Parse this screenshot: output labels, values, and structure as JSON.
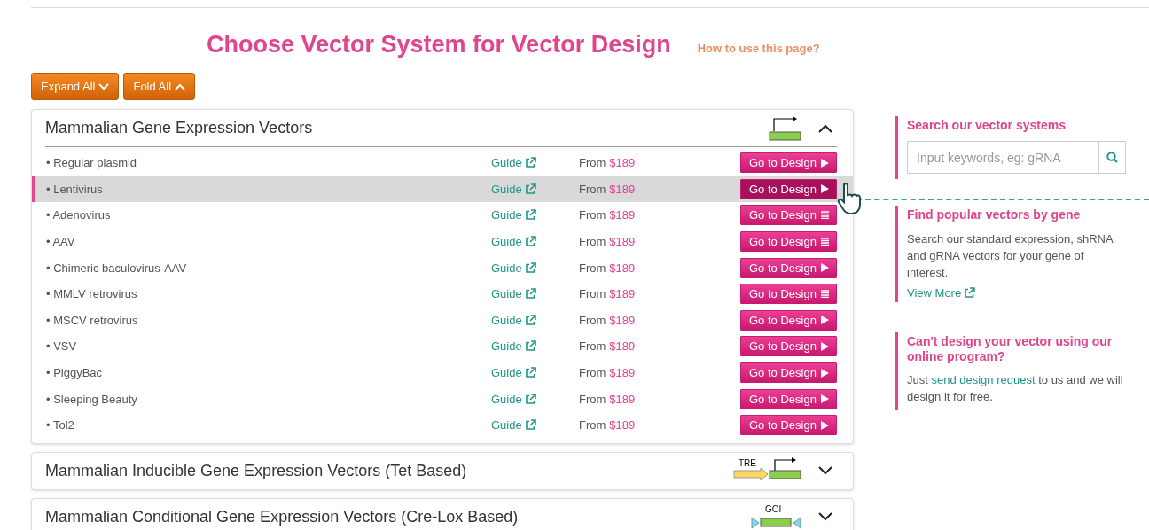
{
  "header": {
    "title": "Choose Vector System for Vector Design",
    "help_link": "How to use this page?"
  },
  "toolbar": [
    {
      "label": "Expand All",
      "kind": "expand"
    },
    {
      "label": "Fold All",
      "kind": "fold"
    }
  ],
  "panels": [
    {
      "title": "Mammalian Gene Expression Vectors",
      "expanded": true,
      "diagram": {
        "kind": "promoter"
      },
      "rows": [
        {
          "name": "• Regular plasmid",
          "guide": "Guide",
          "price_prefix": "From",
          "price": "$189",
          "button": {
            "label": "Go to Design",
            "kind": "play"
          },
          "selected": false
        },
        {
          "name": "• Lentivirus",
          "guide": "Guide",
          "price_prefix": "From",
          "price": "$189",
          "button": {
            "label": "Go to Design",
            "kind": "play"
          },
          "selected": true
        },
        {
          "name": "• Adenovirus",
          "guide": "Guide",
          "price_prefix": "From",
          "price": "$189",
          "button": {
            "label": "Go to Design",
            "kind": "list"
          },
          "selected": false
        },
        {
          "name": "• AAV",
          "guide": "Guide",
          "price_prefix": "From",
          "price": "$189",
          "button": {
            "label": "Go to Design",
            "kind": "list"
          },
          "selected": false
        },
        {
          "name": "• Chimeric baculovirus-AAV",
          "guide": "Guide",
          "price_prefix": "From",
          "price": "$189",
          "button": {
            "label": "Go to Design",
            "kind": "play"
          },
          "selected": false
        },
        {
          "name": "• MMLV retrovirus",
          "guide": "Guide",
          "price_prefix": "From",
          "price": "$189",
          "button": {
            "label": "Go to Design",
            "kind": "list"
          },
          "selected": false
        },
        {
          "name": "• MSCV retrovirus",
          "guide": "Guide",
          "price_prefix": "From",
          "price": "$189",
          "button": {
            "label": "Go to Design",
            "kind": "play"
          },
          "selected": false
        },
        {
          "name": "• VSV",
          "guide": "Guide",
          "price_prefix": "From",
          "price": "$189",
          "button": {
            "label": "Go to Design",
            "kind": "play"
          },
          "selected": false
        },
        {
          "name": "• PiggyBac",
          "guide": "Guide",
          "price_prefix": "From",
          "price": "$189",
          "button": {
            "label": "Go to Design",
            "kind": "play"
          },
          "selected": false
        },
        {
          "name": "• Sleeping Beauty",
          "guide": "Guide",
          "price_prefix": "From",
          "price": "$189",
          "button": {
            "label": "Go to Design",
            "kind": "play"
          },
          "selected": false
        },
        {
          "name": "• Tol2",
          "guide": "Guide",
          "price_prefix": "From",
          "price": "$189",
          "button": {
            "label": "Go to Design",
            "kind": "play"
          },
          "selected": false
        }
      ]
    },
    {
      "title": "Mammalian Inducible Gene Expression Vectors (Tet Based)",
      "expanded": false,
      "diagram": {
        "kind": "tre",
        "label": "TRE"
      }
    },
    {
      "title": "Mammalian Conditional Gene Expression Vectors (Cre-Lox Based)",
      "expanded": false,
      "diagram": {
        "kind": "lox",
        "label": "GOI"
      }
    }
  ],
  "sidebar": {
    "search": {
      "title": "Search our vector systems",
      "placeholder": "Input keywords, eg: gRNA"
    },
    "popular": {
      "title": "Find popular vectors by gene",
      "text": "Search our standard expression, shRNA and gRNA vectors for your gene of interest.",
      "link": "View More"
    },
    "custom": {
      "title": "Can't design your vector using our online program?",
      "text_before": "Just",
      "link": "send design request",
      "text_after": "to us and we will design it for free."
    }
  }
}
